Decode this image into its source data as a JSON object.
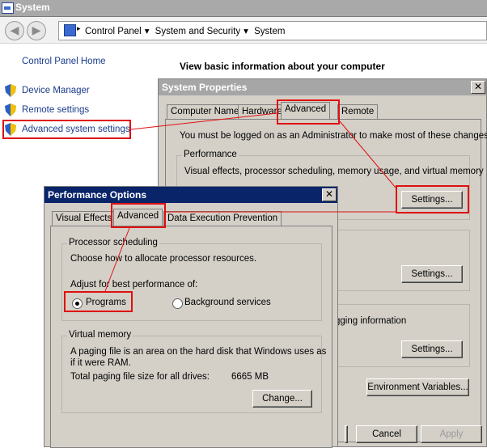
{
  "window": {
    "title": "System"
  },
  "addressbar": {
    "crumbs": [
      "Control Panel",
      "System and Security",
      "System"
    ]
  },
  "sidebar": {
    "home": "Control Panel Home",
    "links": [
      "Device Manager",
      "Remote settings",
      "Advanced system settings"
    ]
  },
  "main": {
    "heading": "View basic information about your computer"
  },
  "system_properties": {
    "title": "System Properties",
    "tabs": [
      "Computer Name",
      "Hardware",
      "Advanced",
      "Remote"
    ],
    "admin_notice": "You must be logged on as an Administrator to make most of these changes.",
    "performance": {
      "label": "Performance",
      "description": "Visual effects, processor scheduling, memory usage, and virtual memory",
      "settings_button": "Settings..."
    },
    "user_profiles": {
      "settings_button": "Settings..."
    },
    "startup_recovery": {
      "partial_text": "gging information",
      "settings_button": "Settings..."
    },
    "env_button": "Environment Variables...",
    "cancel_button": "Cancel",
    "apply_button": "Apply"
  },
  "performance_options": {
    "title": "Performance Options",
    "tabs": [
      "Visual Effects",
      "Advanced",
      "Data Execution Prevention"
    ],
    "processor": {
      "label": "Processor scheduling",
      "description": "Choose how to allocate processor resources.",
      "adjust_label": "Adjust for best performance of:",
      "option_programs": "Programs",
      "option_background": "Background services",
      "selected": "Programs"
    },
    "virtual_memory": {
      "label": "Virtual memory",
      "description_line1": "A paging file is an area on the hard disk that Windows uses as",
      "description_line2": "if it were RAM.",
      "total_label": "Total paging file size for all drives:",
      "total_value": "6665 MB",
      "change_button": "Change..."
    }
  },
  "colors": {
    "annotation": "#e01010",
    "dialog_face": "#d4d0c8",
    "link": "#1a3b8c",
    "title_active": "#0a246a"
  }
}
